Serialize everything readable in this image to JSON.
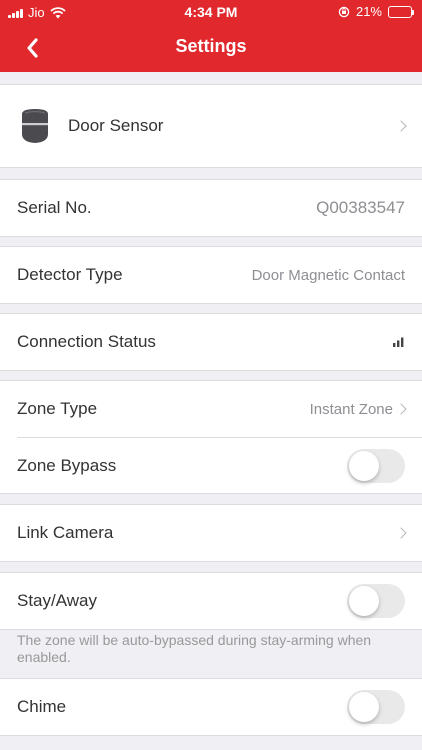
{
  "status_bar": {
    "carrier": "Jio",
    "time": "4:34 PM",
    "battery": "21%",
    "battery_level": 0.21
  },
  "nav": {
    "title": "Settings"
  },
  "device": {
    "name": "Door Sensor"
  },
  "serial": {
    "label": "Serial No.",
    "value": "Q00383547"
  },
  "detector": {
    "label": "Detector Type",
    "value": "Door Magnetic Contact"
  },
  "connection": {
    "label": "Connection Status"
  },
  "zone_type": {
    "label": "Zone Type",
    "value": "Instant Zone"
  },
  "zone_bypass": {
    "label": "Zone Bypass"
  },
  "link_camera": {
    "label": "Link Camera"
  },
  "stay_away": {
    "label": "Stay/Away",
    "note": "The zone will be auto-bypassed during stay-arming when enabled."
  },
  "chime": {
    "label": "Chime"
  },
  "colors": {
    "accent": "#e0282d",
    "background": "#efeff4"
  }
}
